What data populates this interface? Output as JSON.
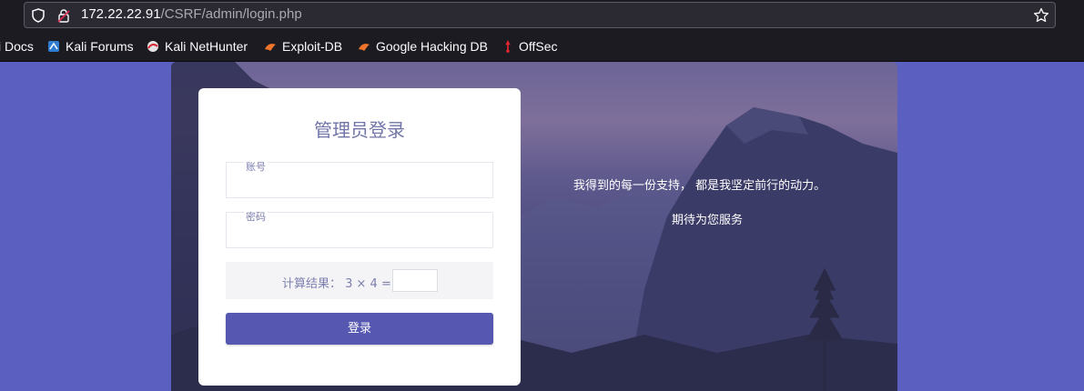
{
  "browser": {
    "url_host": "172.22.22.91",
    "url_path": "/CSRF/admin/login.php"
  },
  "bookmarks": [
    {
      "label": "i Docs",
      "icon": "kali-docs-icon"
    },
    {
      "label": "Kali Forums",
      "icon": "kali-forums-icon"
    },
    {
      "label": "Kali NetHunter",
      "icon": "kali-nethunter-icon"
    },
    {
      "label": "Exploit-DB",
      "icon": "exploit-db-icon"
    },
    {
      "label": "Google Hacking DB",
      "icon": "ghdb-icon"
    },
    {
      "label": "OffSec",
      "icon": "offsec-icon"
    }
  ],
  "login": {
    "title": "管理员登录",
    "account_label": "账号",
    "password_label": "密码",
    "captcha_text": "计算结果： 3 × 4 =",
    "captcha_value": "",
    "submit_label": "登录"
  },
  "hero": {
    "message_line1": "我得到的每一份支持， 都是我坚定前行的动力。",
    "message_line2": "期待为您服务"
  },
  "colors": {
    "page_bg": "#5b5fbf",
    "button": "#5557b0",
    "label": "#7c7fae"
  }
}
